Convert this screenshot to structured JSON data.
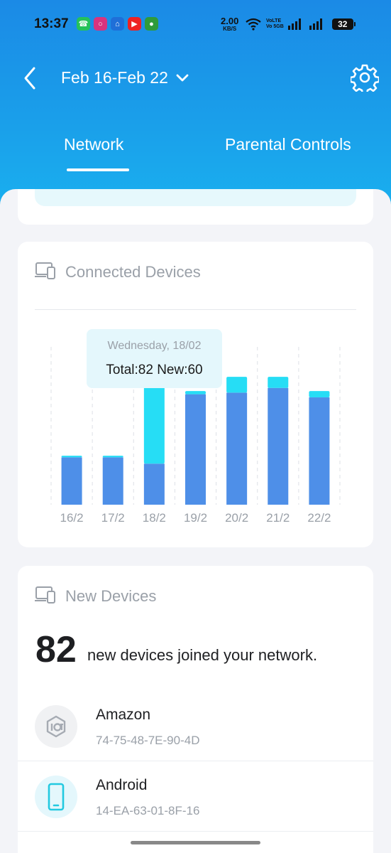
{
  "status_bar": {
    "time": "13:37",
    "net_speed_value": "2.00",
    "net_speed_unit": "KB/S",
    "volte_top": "VoLTE",
    "volte_bottom": "Vo 5GB",
    "battery": "32",
    "app_icons": [
      "whatsapp-icon",
      "instagram-icon",
      "home-icon",
      "youtube-icon",
      "lock-icon"
    ]
  },
  "header": {
    "date_range": "Feb 16-Feb 22",
    "tabs": [
      {
        "label": "Network",
        "active": true
      },
      {
        "label": "Parental Controls",
        "active": false
      }
    ]
  },
  "connected_devices": {
    "title": "Connected Devices",
    "tooltip": {
      "date": "Wednesday, 18/02",
      "values": "Total:82 New:60"
    }
  },
  "chart_data": {
    "type": "bar",
    "stacked": true,
    "categories": [
      "16/2",
      "17/2",
      "18/2",
      "19/2",
      "20/2",
      "21/2",
      "22/2"
    ],
    "series": [
      {
        "name": "",
        "color": "#4e8fe8",
        "values": [
          30,
          30,
          26,
          70,
          71,
          74,
          68
        ]
      },
      {
        "name": "",
        "color": "#26ddf5",
        "values": [
          1,
          1,
          56,
          2,
          10,
          7,
          4
        ]
      }
    ],
    "ylim": [
      0,
      100
    ],
    "grid": "vertical dashed",
    "selected_category": "18/2"
  },
  "new_devices": {
    "title": "New Devices",
    "count": "82",
    "summary": "new devices joined your network.",
    "items": [
      {
        "name": "Amazon",
        "mac": "74-75-48-7E-90-4D",
        "icon": "amazon-device-icon"
      },
      {
        "name": "Android",
        "mac": "14-EA-63-01-8F-16",
        "icon": "phone-icon"
      }
    ]
  },
  "colors": {
    "header_blue": "#1b8ae6",
    "bar_total": "#4e8fe8",
    "bar_new": "#26ddf5",
    "tooltip_bg": "#e4f7fc"
  }
}
